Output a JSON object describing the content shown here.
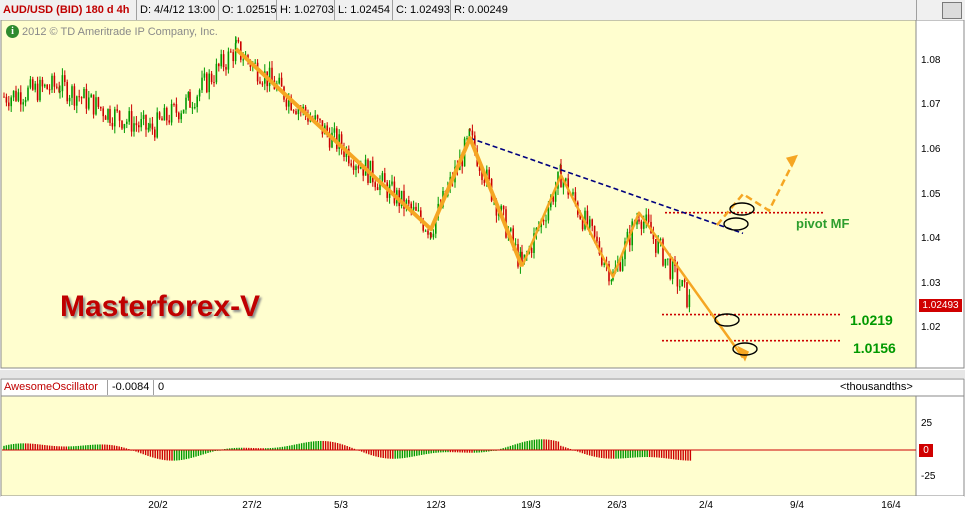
{
  "toolbar": {
    "symbol": "AUD/USD (BID) 180 d 4h",
    "date": "D: 4/4/12 13:00",
    "open": "O: 1.02515",
    "high": "H: 1.02703",
    "low": "L: 1.02454",
    "close": "C: 1.02493",
    "range": "R: 0.00249"
  },
  "copyright": "2012 © TD Ameritrade IP Company, Inc.",
  "brand": "Masterforex-V",
  "indicator": {
    "name": "AwesomeOscillator",
    "value": "-0.0084",
    "zero": "0",
    "units": "<thousandths>",
    "zero_box": "0"
  },
  "colors": {
    "up": "#009900",
    "down": "#cc0000",
    "pattern": "#f5a623",
    "trendline": "#00007f",
    "plot_bg": "#fffecf",
    "level": "#cc0000"
  },
  "chart_data": [
    {
      "type": "candlestick",
      "x_ticks": [
        "20/2",
        "27/2",
        "5/3",
        "12/3",
        "19/3",
        "26/3",
        "2/4",
        "9/4",
        "16/4"
      ],
      "y_ticks": [
        "1.08",
        "1.07",
        "1.06",
        "1.05",
        "1.04",
        "1.03",
        "1.02"
      ],
      "ylim": [
        1.009,
        1.093
      ],
      "last_price": "1.02493",
      "swing_points": [
        {
          "date": "26/2",
          "price": 1.086
        },
        {
          "date": "12/3",
          "price": 1.0425
        },
        {
          "date": "15/3",
          "price": 1.0645
        },
        {
          "date": "19/3",
          "price": 1.0335
        },
        {
          "date": "22/3",
          "price": 1.0555
        },
        {
          "date": "26/3",
          "price": 1.031
        },
        {
          "date": "28/3",
          "price": 1.0465
        },
        {
          "date": "5/4",
          "price": 1.0115
        }
      ],
      "trendline": [
        {
          "date": "15/3",
          "price": 1.0645
        },
        {
          "date": "5/4",
          "price": 1.0415
        }
      ],
      "projection_up": [
        {
          "date": "3/4",
          "price": 1.0435
        },
        {
          "date": "5/4",
          "price": 1.051
        },
        {
          "date": "7/4",
          "price": 1.047
        },
        {
          "date": "9/4",
          "price": 1.0595
        }
      ],
      "levels": [
        {
          "price": 1.0465,
          "label": "pivot MF"
        },
        {
          "price": 1.0219,
          "label": "1.0219"
        },
        {
          "price": 1.0156,
          "label": "1.0156"
        }
      ]
    },
    {
      "type": "bar",
      "name": "AwesomeOscillator",
      "y_ticks": [
        "25",
        "-25"
      ],
      "ylim": [
        -32,
        32
      ],
      "unit": "thousandths"
    }
  ]
}
